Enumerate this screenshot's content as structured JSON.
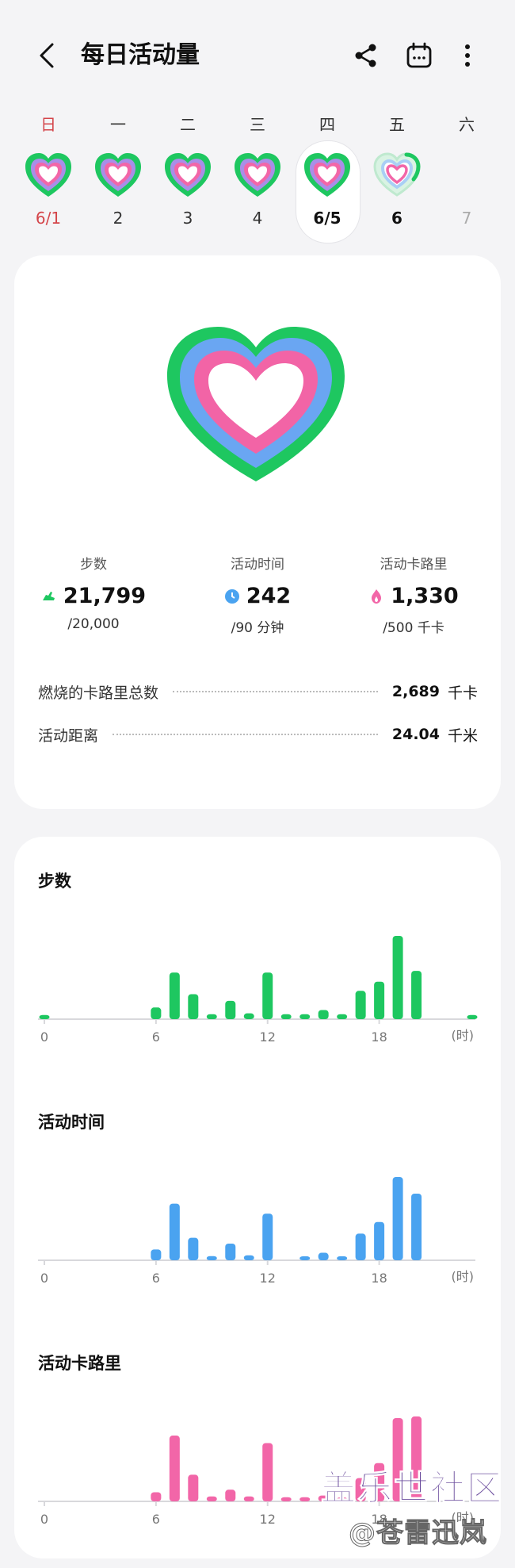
{
  "header": {
    "title": "每日活动量",
    "icons": [
      "back-icon",
      "share-icon",
      "calendar-icon",
      "more-icon"
    ]
  },
  "week": [
    {
      "name": "日",
      "date": "6/1",
      "progress": 1.0
    },
    {
      "name": "一",
      "date": "2",
      "progress": 1.0
    },
    {
      "name": "二",
      "date": "3",
      "progress": 1.0
    },
    {
      "name": "三",
      "date": "4",
      "progress": 1.0
    },
    {
      "name": "四",
      "date": "6/5",
      "progress": 1.0
    },
    {
      "name": "五",
      "date": "6",
      "progress": 0.35
    },
    {
      "name": "六",
      "date": "7",
      "progress": 0
    }
  ],
  "summary": {
    "steps": {
      "label": "步数",
      "value": "21,799",
      "goal": "/20,000"
    },
    "active_time": {
      "label": "活动时间",
      "value": "242",
      "goal": "/90 分钟"
    },
    "active_cal": {
      "label": "活动卡路里",
      "value": "1,330",
      "goal": "/500 千卡"
    },
    "rows": [
      {
        "label": "燃烧的卡路里总数",
        "value": "2,689",
        "unit": "千卡"
      },
      {
        "label": "活动距离",
        "value": "24.04",
        "unit": "千米"
      }
    ]
  },
  "colors": {
    "steps": "#1ec760",
    "time": "#4aa3f0",
    "cal": "#f266a8"
  },
  "chart_data": [
    {
      "type": "bar",
      "title": "步数",
      "x": [
        0,
        1,
        2,
        3,
        4,
        5,
        6,
        7,
        8,
        9,
        10,
        11,
        12,
        13,
        14,
        15,
        16,
        17,
        18,
        19,
        20,
        21,
        22,
        23
      ],
      "values": [
        0.05,
        0,
        0,
        0,
        0,
        0,
        0.14,
        0.56,
        0.3,
        0.06,
        0.22,
        0.07,
        0.56,
        0.06,
        0.06,
        0.11,
        0.06,
        0.34,
        0.45,
        1.0,
        0.58,
        0,
        0,
        0.05
      ],
      "xticks": [
        "0",
        "6",
        "12",
        "18"
      ],
      "xunit": "(时)"
    },
    {
      "type": "bar",
      "title": "活动时间",
      "x": [
        0,
        1,
        2,
        3,
        4,
        5,
        6,
        7,
        8,
        9,
        10,
        11,
        12,
        13,
        14,
        15,
        16,
        17,
        18,
        19,
        20,
        21,
        22,
        23
      ],
      "values": [
        0,
        0,
        0,
        0,
        0,
        0,
        0.13,
        0.68,
        0.27,
        0.05,
        0.2,
        0.06,
        0.56,
        0,
        0.04,
        0.09,
        0.04,
        0.32,
        0.46,
        1.0,
        0.8,
        0,
        0,
        0
      ],
      "xticks": [
        "0",
        "6",
        "12",
        "18"
      ],
      "xunit": "(时)"
    },
    {
      "type": "bar",
      "title": "活动卡路里",
      "x": [
        0,
        1,
        2,
        3,
        4,
        5,
        6,
        7,
        8,
        9,
        10,
        11,
        12,
        13,
        14,
        15,
        16,
        17,
        18,
        19,
        20,
        21,
        22,
        23
      ],
      "values": [
        0,
        0,
        0,
        0,
        0,
        0,
        0.11,
        0.79,
        0.32,
        0.06,
        0.14,
        0.06,
        0.7,
        0.05,
        0.05,
        0.07,
        0.04,
        0.28,
        0.46,
        1.0,
        1.02,
        0,
        0,
        0
      ],
      "xticks": [
        "0",
        "6",
        "12",
        "18"
      ],
      "xunit": "(时)"
    }
  ],
  "watermark": {
    "line1": "盖乐世社区",
    "line2": "@苍雷迅岚"
  }
}
